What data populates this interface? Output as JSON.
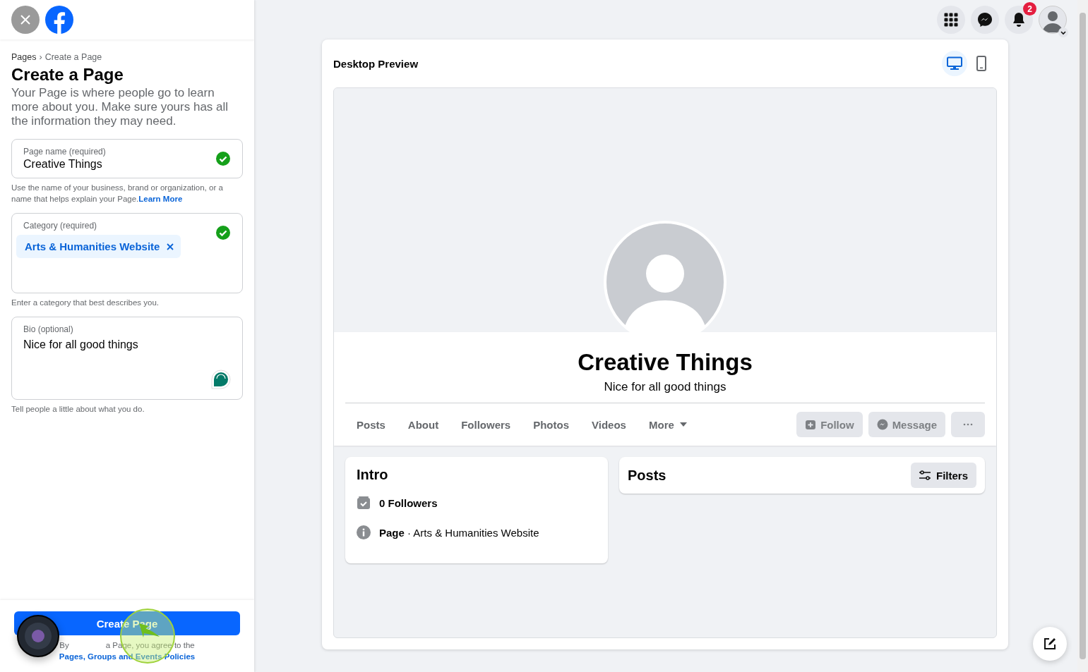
{
  "breadcrumb": [
    "Pages",
    "Create a Page"
  ],
  "breadcrumb_separator": "›",
  "title": "Create a Page",
  "description": "Your Page is where people go to learn more about you. Make sure yours has all the information they may need.",
  "fields": [
    {
      "kind": "text",
      "label": "Page name (required)",
      "value": "Creative Things",
      "valid": true,
      "helper": "Use the name of your business, brand or organization, or a name that helps explain your Page.",
      "helper_link": "Learn More"
    },
    {
      "kind": "tags",
      "label": "Category (required)",
      "tags": [
        "Arts & Humanities Website"
      ],
      "valid": true,
      "helper": "Enter a category that best describes you."
    },
    {
      "kind": "textarea",
      "label": "Bio (optional)",
      "value": "Nice for all good things",
      "helper": "Tell people a little about what you do."
    }
  ],
  "footer": {
    "button": "Create Page",
    "terms_start": "By",
    "terms_rest": "a Page, you agree to the",
    "terms_link": "Pages, Groups and Events Policies"
  },
  "topbar": {
    "notifications": "2"
  },
  "preview": {
    "title": "Desktop Preview",
    "view_modes": [
      {
        "kind": "desktop",
        "selected": true
      },
      {
        "kind": "mobile",
        "selected": false
      }
    ],
    "page_name": "Creative Things",
    "bio": "Nice for all good things",
    "tabs": [
      {
        "label": "Posts",
        "dropdown": false
      },
      {
        "label": "About",
        "dropdown": false
      },
      {
        "label": "Followers",
        "dropdown": false
      },
      {
        "label": "Photos",
        "dropdown": false
      },
      {
        "label": "Videos",
        "dropdown": false
      },
      {
        "label": "More",
        "dropdown": true
      }
    ],
    "actions": [
      {
        "kind": "follow",
        "label": "Follow",
        "disabled": true
      },
      {
        "kind": "message",
        "label": "Message",
        "disabled": true
      },
      {
        "kind": "more",
        "disabled": true
      }
    ],
    "intro": {
      "title": "Intro",
      "items": [
        {
          "kind": "followers",
          "text": "**0 Followers**"
        },
        {
          "kind": "info",
          "text": "**Page** · Arts & Humanities Website"
        }
      ]
    },
    "posts": {
      "title": "Posts",
      "filter": "Filters"
    }
  }
}
